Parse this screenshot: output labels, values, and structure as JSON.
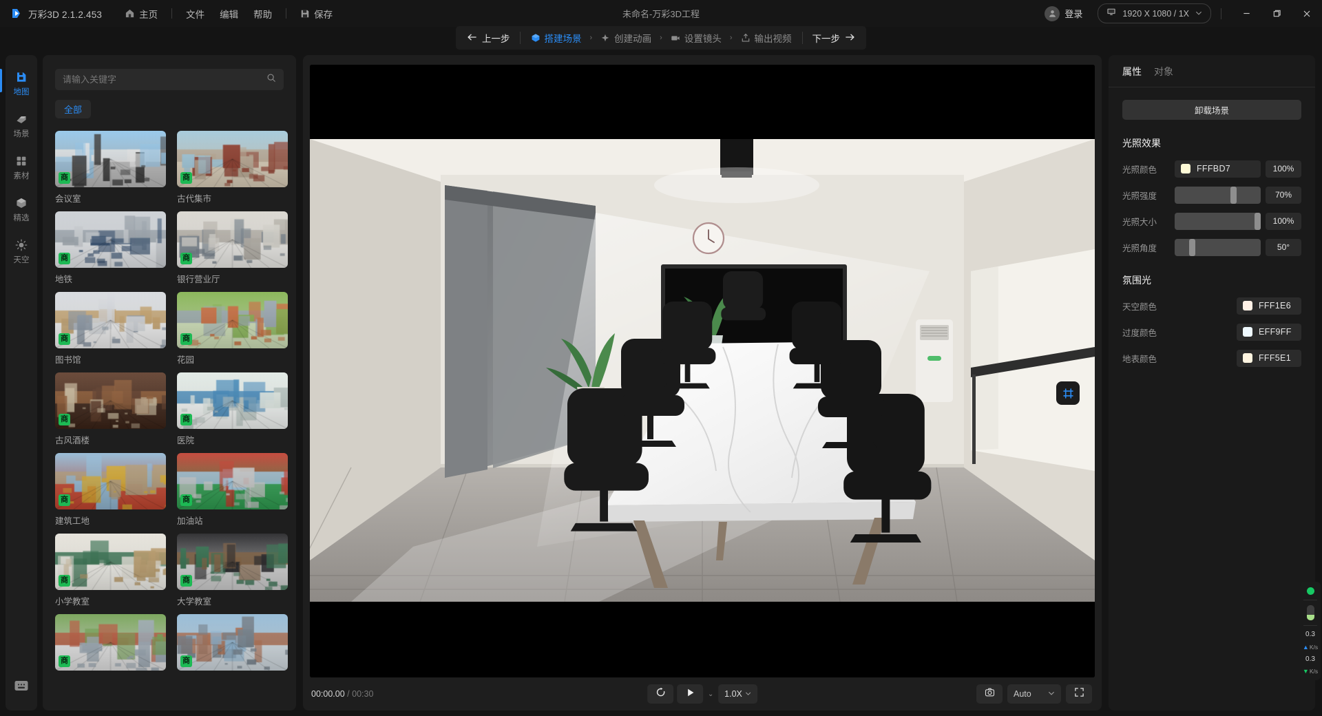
{
  "titlebar": {
    "brand": "万彩3D 2.1.2.453",
    "home": "主页",
    "menus": [
      "文件",
      "编辑",
      "帮助"
    ],
    "save": "保存",
    "project_title": "未命名-万彩3D工程",
    "login": "登录",
    "resolution": "1920 X 1080 / 1X",
    "icons": {
      "logo": "app-logo-icon",
      "home": "home-icon",
      "save": "save-icon",
      "avatar": "avatar-icon",
      "monitor": "monitor-icon",
      "chevron": "chevron-down-icon",
      "minimize": "minimize-icon",
      "maximize": "restore-icon",
      "close": "close-icon"
    }
  },
  "stepbar": {
    "prev": "上一步",
    "next": "下一步",
    "steps": [
      {
        "label": "搭建场景",
        "icon": "cube-icon",
        "active": true
      },
      {
        "label": "创建动画",
        "icon": "spark-icon",
        "active": false
      },
      {
        "label": "设置镜头",
        "icon": "camera-icon",
        "active": false
      },
      {
        "label": "输出视频",
        "icon": "export-icon",
        "active": false
      }
    ],
    "separator": "›"
  },
  "rail": {
    "items": [
      {
        "label": "地图",
        "icon": "map-icon",
        "active": true
      },
      {
        "label": "场景",
        "icon": "scene-icon",
        "active": false
      },
      {
        "label": "素材",
        "icon": "assets-icon",
        "active": false
      },
      {
        "label": "精选",
        "icon": "featured-cube-icon",
        "active": false
      },
      {
        "label": "天空",
        "icon": "sky-sun-icon",
        "active": false
      }
    ],
    "bottom_icon": "message-icon"
  },
  "library": {
    "search_placeholder": "请输入关键字",
    "search_value": "",
    "search_icon": "search-icon",
    "filters": [
      {
        "label": "全部",
        "active": true
      }
    ],
    "badge_text": "商",
    "cards": [
      {
        "label": "会议室",
        "badge": "商",
        "palette": [
          "#8fc4e8",
          "#e8e8e8",
          "#3a3a3a",
          "#b9b9b9"
        ],
        "kind": "room"
      },
      {
        "label": "古代集市",
        "badge": "商",
        "palette": [
          "#9fc6d8",
          "#b8a893",
          "#8c3a2a",
          "#d9cdb8"
        ],
        "kind": "street"
      },
      {
        "label": "地铁",
        "badge": "商",
        "palette": [
          "#c9cdd2",
          "#9aa3ab",
          "#2f4a6b",
          "#e3e6e9"
        ],
        "kind": "hall"
      },
      {
        "label": "银行营业厅",
        "badge": "商",
        "palette": [
          "#d7d4cd",
          "#b1adA4",
          "#6f7b86",
          "#ecebe7"
        ],
        "kind": "hall"
      },
      {
        "label": "图书馆",
        "badge": "商",
        "palette": [
          "#d5d8dc",
          "#c3a06a",
          "#8d99a6",
          "#efefef"
        ],
        "kind": "hall"
      },
      {
        "label": "花园",
        "badge": "商",
        "palette": [
          "#7fb04a",
          "#9aa6b2",
          "#c96a3a",
          "#cfe0b8"
        ],
        "kind": "garden"
      },
      {
        "label": "古风酒楼",
        "badge": "商",
        "palette": [
          "#5b3826",
          "#8e5a34",
          "#c7b79a",
          "#3b2317"
        ],
        "kind": "interior"
      },
      {
        "label": "医院",
        "badge": "商",
        "palette": [
          "#dfe8e3",
          "#3f86b8",
          "#b9c6c2",
          "#f2f5f3"
        ],
        "kind": "ward"
      },
      {
        "label": "建筑工地",
        "badge": "商",
        "palette": [
          "#8fb7d4",
          "#b09a78",
          "#d4a72c",
          "#c0452f"
        ],
        "kind": "site"
      },
      {
        "label": "加油站",
        "badge": "商",
        "palette": [
          "#c0392b",
          "#9fc8e0",
          "#c6c6c6",
          "#2e9b4f"
        ],
        "kind": "station"
      },
      {
        "label": "小学教室",
        "badge": "商",
        "palette": [
          "#e4e1d8",
          "#2f6b4a",
          "#b99a68",
          "#f0efe9"
        ],
        "kind": "class"
      },
      {
        "label": "大学教室",
        "badge": "商",
        "palette": [
          "#1d1d20",
          "#7b5a3a",
          "#2f6b4a",
          "#cfcfcf"
        ],
        "kind": "lecture"
      },
      {
        "label": "",
        "badge": "商",
        "palette": [
          "#6f9e4e",
          "#b4543a",
          "#9aa7b2",
          "#e2e2e2"
        ],
        "kind": "stadium"
      },
      {
        "label": "",
        "badge": "商",
        "palette": [
          "#8fb7d4",
          "#a9694a",
          "#6f7b86",
          "#cfd8de"
        ],
        "kind": "city"
      }
    ]
  },
  "viewport": {
    "frame_button_icon": "frame-grid-icon",
    "playbar": {
      "current_time": "00:00.00",
      "separator": "/",
      "total_time": "00:30",
      "loop_icon": "loop-icon",
      "play_icon": "play-icon",
      "speed": "1.0X",
      "camera_icon": "screenshot-camera-icon",
      "quality": "Auto",
      "fullscreen_icon": "fullscreen-icon",
      "chevron": "⌄"
    }
  },
  "properties": {
    "tabs": [
      {
        "label": "属性",
        "active": true
      },
      {
        "label": "对象",
        "active": false
      }
    ],
    "unload_button": "卸载场景",
    "lighting": {
      "title": "光照效果",
      "rows": [
        {
          "label": "光照颜色",
          "type": "color",
          "hex": "FFFBD7",
          "swatch": "#FFFBD7",
          "value": "100%"
        },
        {
          "label": "光照强度",
          "type": "slider",
          "percent": 70,
          "value": "70%"
        },
        {
          "label": "光照大小",
          "type": "slider",
          "percent": 100,
          "value": "100%"
        },
        {
          "label": "光照角度",
          "type": "slider",
          "percent": 18,
          "value": "50°"
        }
      ]
    },
    "ambient": {
      "title": "氛围光",
      "rows": [
        {
          "label": "天空颜色",
          "hex": "FFF1E6",
          "swatch": "#FFF1E6"
        },
        {
          "label": "过度颜色",
          "hex": "EFF9FF",
          "swatch": "#EFF9FF"
        },
        {
          "label": "地表颜色",
          "hex": "FFF5E1",
          "swatch": "#FFF5E1"
        }
      ]
    }
  },
  "stats": {
    "status_color": "#17c964",
    "battery_percent": 38,
    "upload": {
      "value": "0.3",
      "unit": "K/s",
      "arrow": "▲"
    },
    "download": {
      "value": "0.3",
      "unit": "K/s",
      "arrow": "▼"
    }
  }
}
